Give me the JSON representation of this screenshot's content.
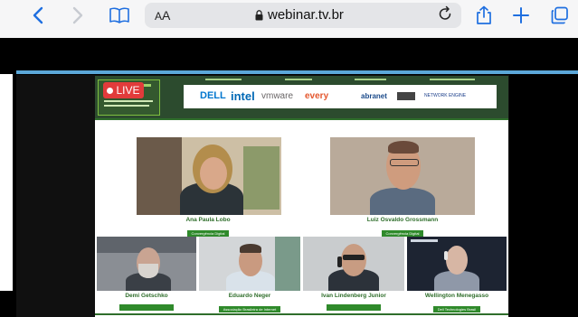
{
  "browser": {
    "text_size_label_small": "A",
    "text_size_label_big": "A",
    "url": "webinar.tv.br"
  },
  "icons": {
    "back": "chevron-left-icon",
    "forward": "chevron-right-icon",
    "bookmarks": "book-icon",
    "lock": "lock-icon",
    "reload": "reload-icon",
    "share": "share-icon",
    "add": "plus-icon",
    "tabs": "tabs-icon"
  },
  "stream": {
    "live_label": "LIVE",
    "sponsors": [
      "DELL",
      "intel",
      "vmware",
      "every",
      "abranet",
      "",
      "NETWORK ENGINE"
    ],
    "sponsor_colors": [
      "#0076ce",
      "#0068b5",
      "#696566",
      "#e4572e",
      "#1a4a8a",
      "#333333",
      "#1a3e8a"
    ]
  },
  "participants": [
    {
      "name": "Ana Paula Lobo",
      "org": "Convergência Digital"
    },
    {
      "name": "Luiz Osvaldo Grossmann",
      "org": "Convergência Digital"
    },
    {
      "name": "Demi Getschko",
      "org": ""
    },
    {
      "name": "Eduardo Neger",
      "org": "Associação Brasileira de Internet"
    },
    {
      "name": "Ivan Lindenberg Junior",
      "org": ""
    },
    {
      "name": "Wellington Menegasso",
      "org": "Dell Technologies Brasil"
    }
  ],
  "colors": {
    "accent": "#1f6fe0",
    "brand_green": "#2f6e2b",
    "live_red": "#e23b3b"
  }
}
